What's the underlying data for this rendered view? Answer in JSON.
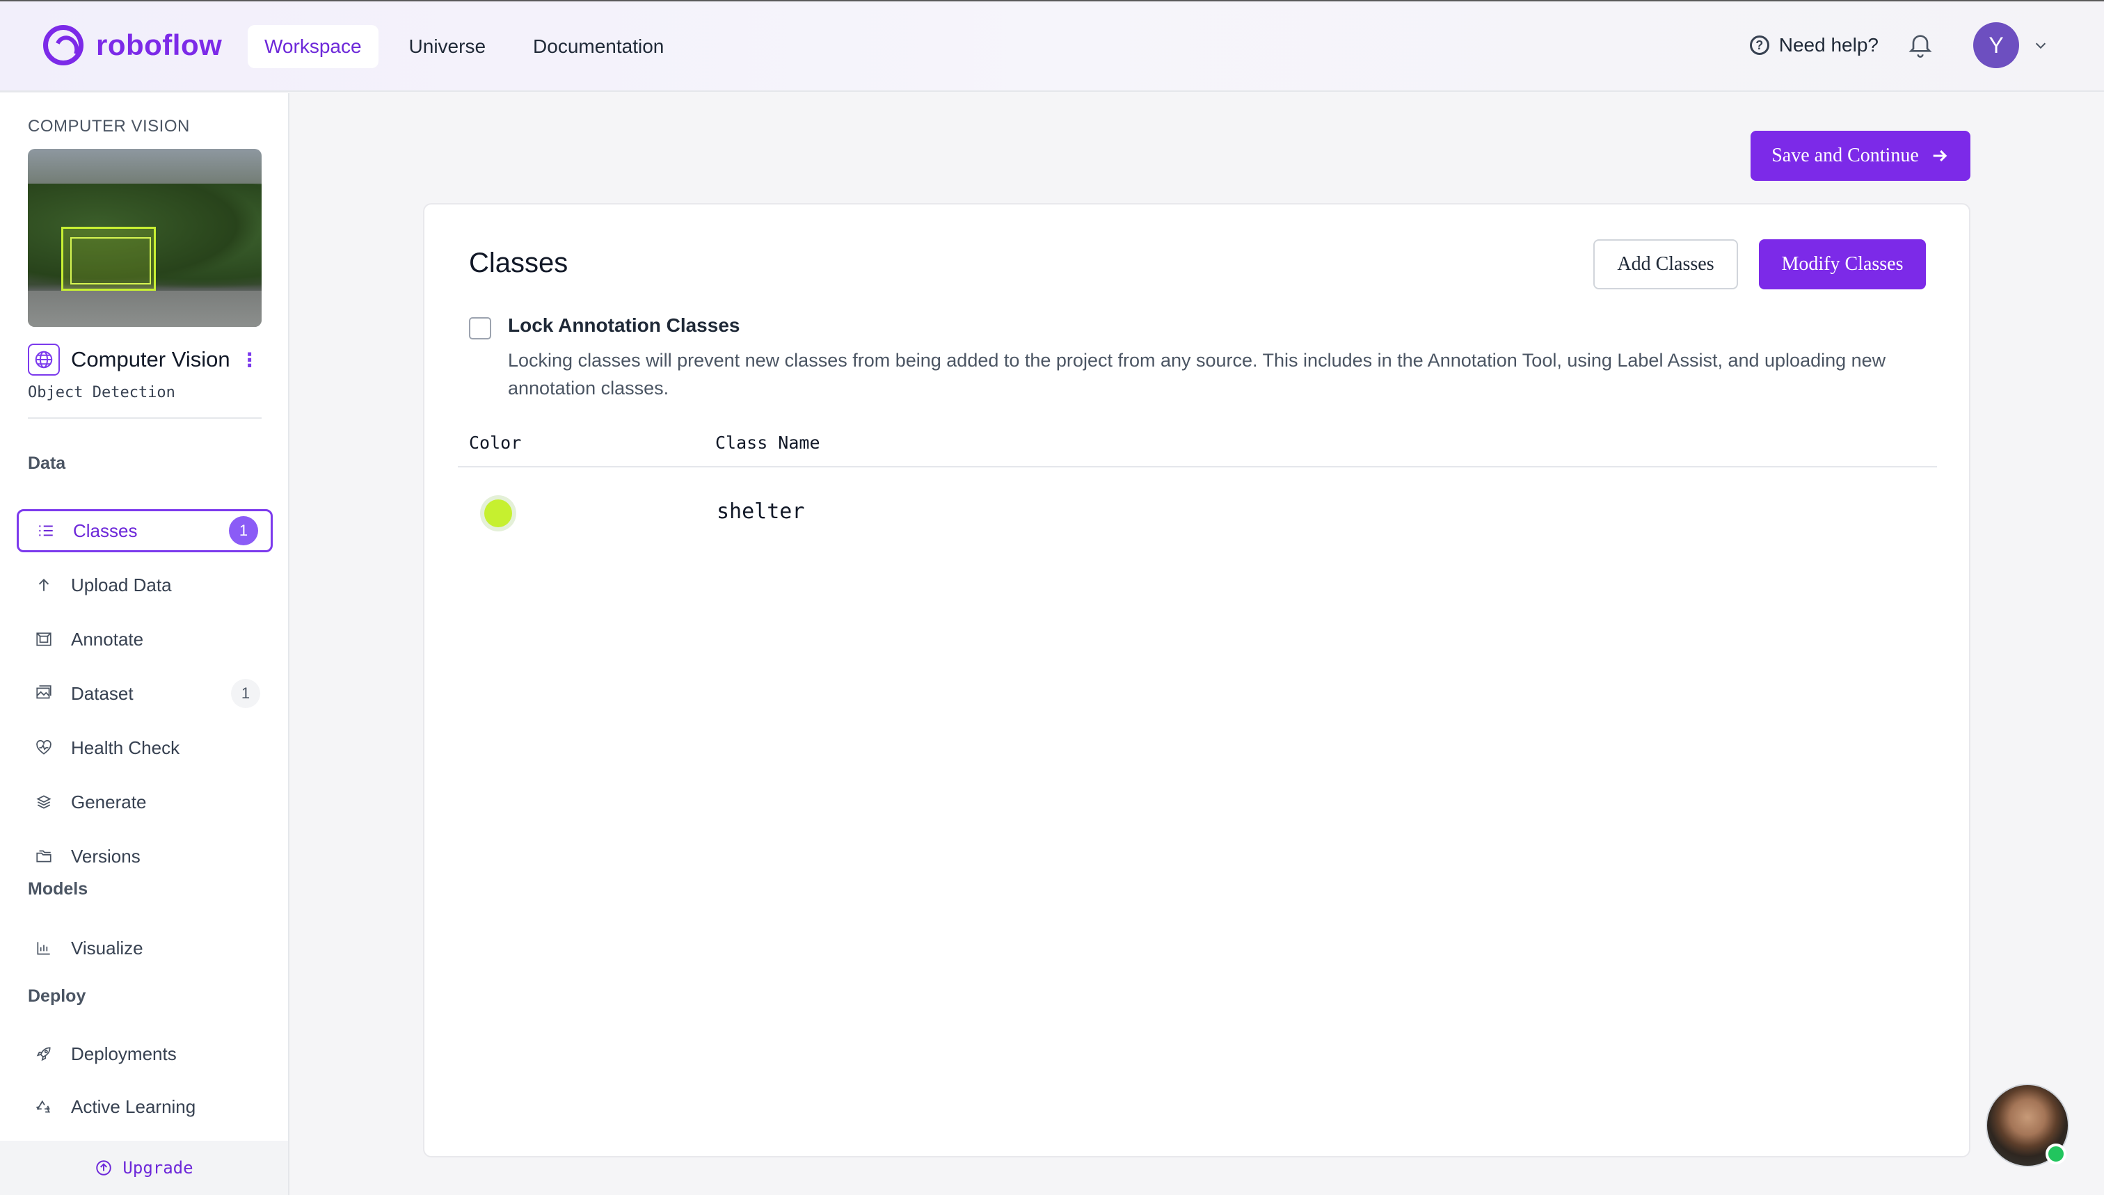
{
  "brand": {
    "name": "roboflow",
    "accent": "#7c2ae8"
  },
  "nav": {
    "tabs": [
      {
        "label": "Workspace",
        "active": true
      },
      {
        "label": "Universe",
        "active": false
      },
      {
        "label": "Documentation",
        "active": false
      }
    ],
    "help_label": "Need help?",
    "avatar_initial": "Y"
  },
  "sidebar": {
    "kicker": "COMPUTER VISION",
    "project_name": "Computer Vision",
    "project_type": "Object Detection",
    "sections": {
      "data": "Data",
      "models": "Models",
      "deploy": "Deploy"
    },
    "items": [
      {
        "label": "Classes",
        "icon": "list-icon",
        "badge": "1",
        "active": true
      },
      {
        "label": "Upload Data",
        "icon": "upload-arrow-icon"
      },
      {
        "label": "Annotate",
        "icon": "annotate-icon"
      },
      {
        "label": "Dataset",
        "icon": "images-icon",
        "badge": "1"
      },
      {
        "label": "Health Check",
        "icon": "heart-pulse-icon"
      },
      {
        "label": "Generate",
        "icon": "layers-icon"
      },
      {
        "label": "Versions",
        "icon": "folders-icon"
      },
      {
        "label": "Visualize",
        "icon": "bar-chart-icon"
      },
      {
        "label": "Deployments",
        "icon": "rocket-icon"
      },
      {
        "label": "Active Learning",
        "icon": "recycle-icon"
      }
    ],
    "upgrade_label": "Upgrade"
  },
  "main": {
    "save_label": "Save and Continue",
    "title": "Classes",
    "add_classes_label": "Add Classes",
    "modify_classes_label": "Modify Classes",
    "lock": {
      "title": "Lock Annotation Classes",
      "description": "Locking classes will prevent new classes from being added to the project from any source. This includes in the Annotation Tool, using Label Assist, and uploading new annotation classes.",
      "checked": false
    },
    "table": {
      "headers": [
        "Color",
        "Class Name"
      ],
      "rows": [
        {
          "color": "#c6f02f",
          "class_name": "shelter"
        }
      ]
    }
  }
}
